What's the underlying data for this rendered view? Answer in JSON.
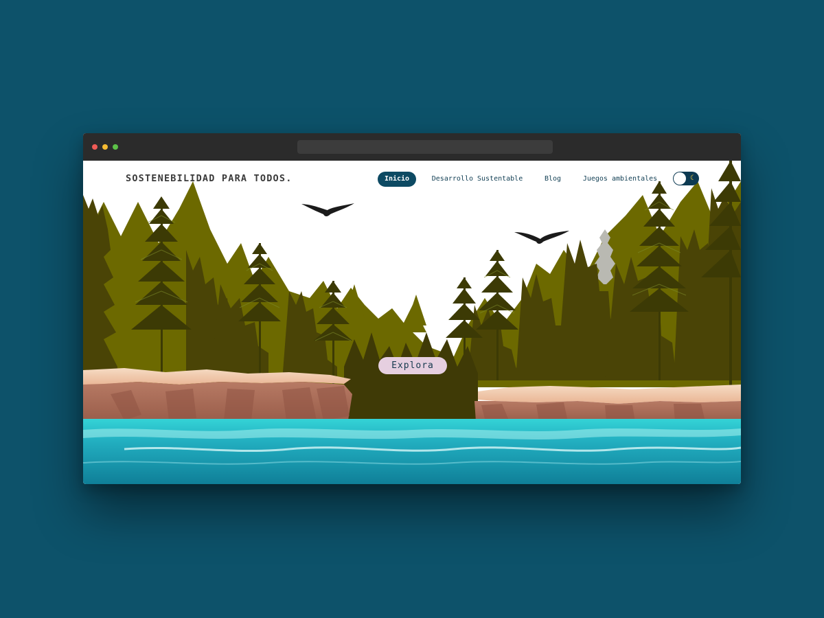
{
  "site": {
    "brand": "SOSTENEBILIDAD PARA TODOS."
  },
  "nav": {
    "items": [
      {
        "label": "Inicio",
        "active": true
      },
      {
        "label": "Desarrollo Sustentable",
        "active": false
      },
      {
        "label": "Blog",
        "active": false
      },
      {
        "label": "Juegos ambientales",
        "active": false
      }
    ]
  },
  "theme_toggle": {
    "icon": "moon-icon",
    "state": "off"
  },
  "hero": {
    "cta_label": "Explora"
  },
  "colors": {
    "page_background": "#0d526a",
    "nav_active": "#0d4a63",
    "cta_background": "#e6cfe0",
    "forest_olive": "#6e6a00",
    "forest_dark": "#3f3a06",
    "water": "#1a9ab0"
  }
}
